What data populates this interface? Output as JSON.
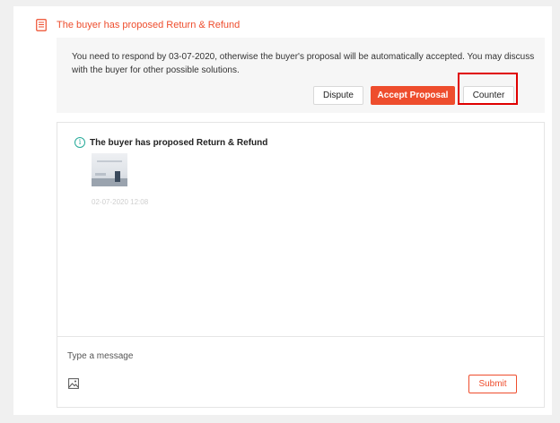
{
  "header": {
    "title": "The buyer has proposed Return & Refund",
    "icon": "document-list-icon",
    "accent_color": "#ee4d2d"
  },
  "notice": {
    "text": "You need to respond by 03-07-2020, otherwise the buyer's proposal will be automatically accepted. You may discuss with the buyer for other possible solutions.",
    "buttons": {
      "dispute": "Dispute",
      "accept": "Accept Proposal",
      "counter": "Counter"
    }
  },
  "chat": {
    "message_title": "The buyer has proposed Return & Refund",
    "info_icon": "info-icon",
    "timestamp": "02-07-2020 12:08",
    "input_placeholder": "Type a message",
    "image_icon": "image-icon",
    "submit_label": "Submit"
  },
  "annotation": {
    "highlight_color": "#e00000"
  }
}
